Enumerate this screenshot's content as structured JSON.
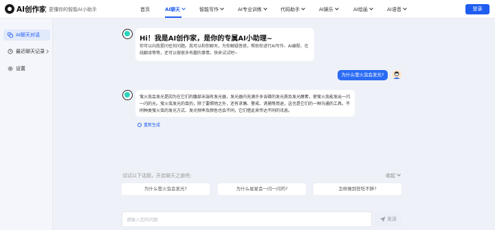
{
  "header": {
    "brand": "AI创作家",
    "slogan": "更懂你的智能AI小助手",
    "nav": [
      {
        "label": "首页",
        "dropdown": false
      },
      {
        "label": "AI聊天",
        "dropdown": true
      },
      {
        "label": "智能写作",
        "dropdown": true
      },
      {
        "label": "AI专业训练",
        "dropdown": true
      },
      {
        "label": "代码助手",
        "dropdown": true
      },
      {
        "label": "AI娱乐",
        "dropdown": true
      },
      {
        "label": "AI绘画",
        "dropdown": true
      },
      {
        "label": "AI语音",
        "dropdown": true
      }
    ],
    "login": "登录"
  },
  "sidebar": {
    "items": [
      {
        "label": "AI聊天对话",
        "icon": "chat-bubbles-icon"
      },
      {
        "label": "最近聊天记录",
        "icon": "clock-icon"
      },
      {
        "label": "设置",
        "icon": "gear-icon"
      }
    ]
  },
  "chat": {
    "greeting_title": "Hi！我是AI创作家，是你的专属AI小助理~",
    "greeting_sub": "你可以向我提问任何问题。我可以和你聊天，为你解疑答惑，帮助你进行AI写作、AI编程、在线翻译等等，还可以做很多有趣的事情，快来试试吧~",
    "user_question": "为什么萤火虫会发光?",
    "answer": "萤火虫会发光是因为在它们的腹部末端有发光器，发光器内充满许多含磷的发光质及发光酵素，使萤火虫能发出一闪一闪的光。萤火虫发光的目的，除了要照明之外，还有求偶、警戒、诱捕等用途，这也是它们的一种沟通的工具。不同种类萤火虫的发光方式、发光频率及颜色也会不同，它们借此来传达不同的讯息。",
    "regenerate": "重新生成"
  },
  "suggestions": {
    "label": "试试以下话题，开启聊天之旅吧:",
    "collapse": "收起",
    "chips": [
      "为什么萤火虫会发光?",
      "为什么星星会一闪一闪的?",
      "怎样做到狂吃不胖?"
    ]
  },
  "input": {
    "placeholder": "请输入您的问题",
    "send": "发送"
  },
  "colors": {
    "accent": "#1f5cf0",
    "user_bubble": "#2c6cf5",
    "bot_avatar": "#2ad4c0"
  }
}
